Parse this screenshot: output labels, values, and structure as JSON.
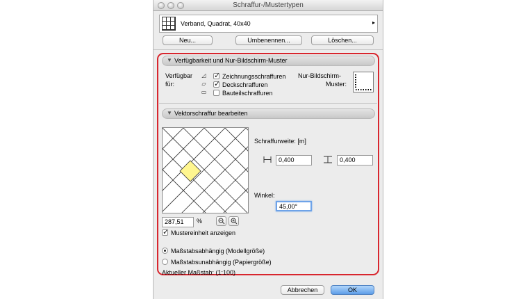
{
  "window": {
    "title": "Schraffur-/Mustertypen"
  },
  "pattern_selector": {
    "value": "Verband, Quadrat, 40x40"
  },
  "buttons": {
    "new": "Neu...",
    "rename": "Umbenennen...",
    "delete": "Löschen..."
  },
  "availability": {
    "header": "Verfügbarkeit und Nur-Bildschirm-Muster",
    "label_line1": "Verfügbar",
    "label_line2": "für:",
    "options": [
      {
        "label": "Zeichnungsschraffuren",
        "checked": true,
        "icon": "drafting-fill-icon"
      },
      {
        "label": "Deckschraffuren",
        "checked": true,
        "icon": "cover-fill-icon"
      },
      {
        "label": "Bauteilschraffuren",
        "checked": false,
        "icon": "cut-fill-icon"
      }
    ],
    "screen_only_label_line1": "Nur-Bildschirm-",
    "screen_only_label_line2": "Muster:"
  },
  "vector": {
    "header": "Vektorschraffur bearbeiten",
    "spacing_label": "Schraffurweite: [m]",
    "spacing_h": "0,400",
    "spacing_v": "0,400",
    "angle_label": "Winkel:",
    "angle": "45,00°",
    "zoom": "287,51",
    "zoom_unit": "%",
    "show_unit_label": "Mustereinheit anzeigen",
    "show_unit_checked": true
  },
  "scale": {
    "option_model": "Maßstabsabhängig (Modellgröße)",
    "option_paper": "Maßstabsunabhängig (Papiergröße)",
    "selected": "model",
    "current": "Aktueller Maßstab: (1:100)"
  },
  "footer": {
    "cancel": "Abbrechen",
    "ok": "OK"
  },
  "colors": {
    "highlight_frame": "#d8262e",
    "unit_cell": "#fff68f",
    "focus": "#6ea3e8"
  }
}
